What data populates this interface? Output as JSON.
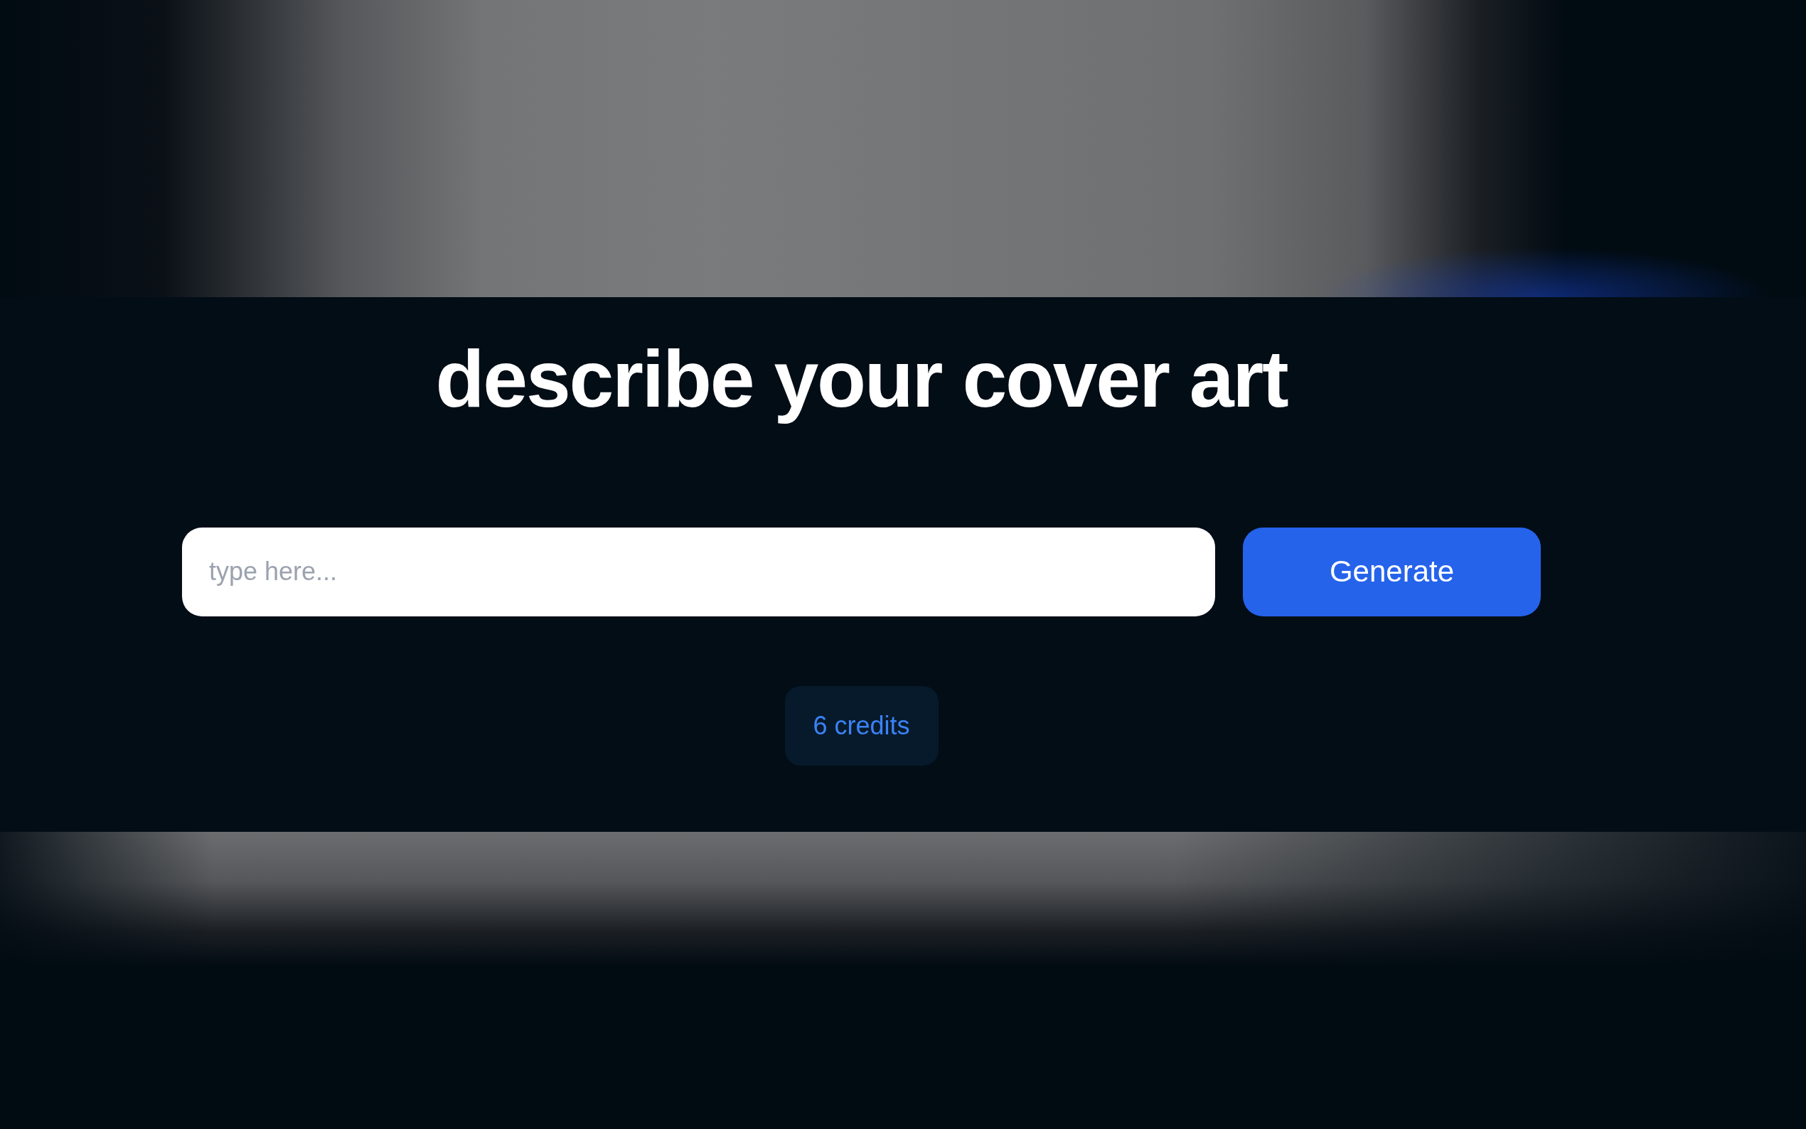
{
  "heading": "describe your cover art",
  "prompt": {
    "placeholder": "type here..."
  },
  "generate_button": {
    "label": "Generate"
  },
  "credits": "6 credits"
}
